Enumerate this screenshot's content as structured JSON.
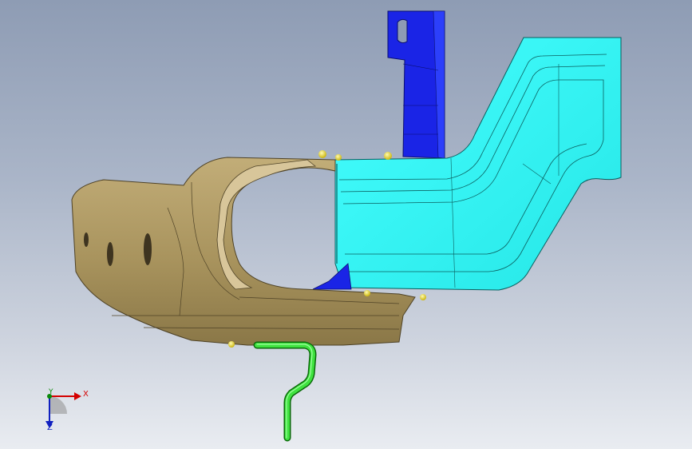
{
  "viewport": {
    "background_top": "#8e9cb4",
    "background_bottom": "#e9ecf1"
  },
  "model": {
    "parts": [
      {
        "name": "bracket-part",
        "color": "#1a24e6"
      },
      {
        "name": "rail-part",
        "color": "#33f5f5"
      },
      {
        "name": "shell-part",
        "color": "#b09a64"
      },
      {
        "name": "pipe-part",
        "color": "#33dd33"
      },
      {
        "name": "weld-spot",
        "color": "#e8e020"
      }
    ]
  },
  "triad": {
    "x_label": "X",
    "y_label": "Y",
    "z_label": "Z",
    "x_color": "#d40000",
    "y_color": "#0a8a0a",
    "z_color": "#1020c0"
  }
}
